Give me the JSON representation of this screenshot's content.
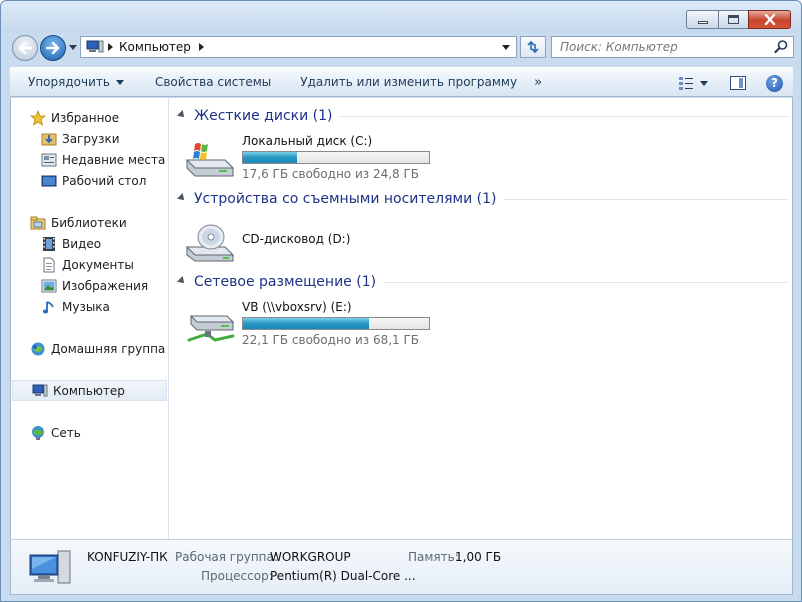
{
  "navigation": {
    "address_segments": [
      "Компьютер"
    ],
    "search_placeholder": "Поиск: Компьютер"
  },
  "toolbar": {
    "organize_label": "Упорядочить",
    "system_properties_label": "Свойства системы",
    "uninstall_label": "Удалить или изменить программу",
    "more_label": "»"
  },
  "sidebar": {
    "favorites": {
      "label": "Избранное",
      "items": [
        {
          "label": "Загрузки",
          "icon": "downloads-folder-icon"
        },
        {
          "label": "Недавние места",
          "icon": "recent-places-icon"
        },
        {
          "label": "Рабочий стол",
          "icon": "desktop-icon"
        }
      ]
    },
    "libraries": {
      "label": "Библиотеки",
      "items": [
        {
          "label": "Видео",
          "icon": "video-icon"
        },
        {
          "label": "Документы",
          "icon": "documents-icon"
        },
        {
          "label": "Изображения",
          "icon": "pictures-icon"
        },
        {
          "label": "Музыка",
          "icon": "music-icon"
        }
      ]
    },
    "homegroup": {
      "label": "Домашняя группа"
    },
    "computer": {
      "label": "Компьютер"
    },
    "network": {
      "label": "Сеть"
    }
  },
  "groups": [
    {
      "title": "Жесткие диски (1)",
      "drives": [
        {
          "name": "Локальный диск (C:)",
          "free_text": "17,6 ГБ свободно из 24,8 ГБ",
          "used_fraction": 0.29,
          "icon": "windows-drive-icon"
        }
      ]
    },
    {
      "title": "Устройства со съемными носителями (1)",
      "drives": [
        {
          "name": "CD-дисковод (D:)",
          "icon": "cd-drive-icon"
        }
      ]
    },
    {
      "title": "Сетевое размещение (1)",
      "drives": [
        {
          "name": "VB (\\\\vboxsrv) (E:)",
          "free_text": "22,1 ГБ свободно из 68,1 ГБ",
          "used_fraction": 0.68,
          "icon": "network-drive-icon"
        }
      ]
    }
  ],
  "details": {
    "computer_name": "KONFUZIY-ПК",
    "workgroup_label": "Рабочая группа:",
    "workgroup_value": "WORKGROUP",
    "memory_label": "Память:",
    "memory_value": "1,00 ГБ",
    "processor_label": "Процессор:",
    "processor_value": "Pentium(R) Dual-Core ..."
  },
  "colors": {
    "group_header": "#1e3287",
    "progress_fill": "#2698c3",
    "close_button": "#c8432c"
  }
}
